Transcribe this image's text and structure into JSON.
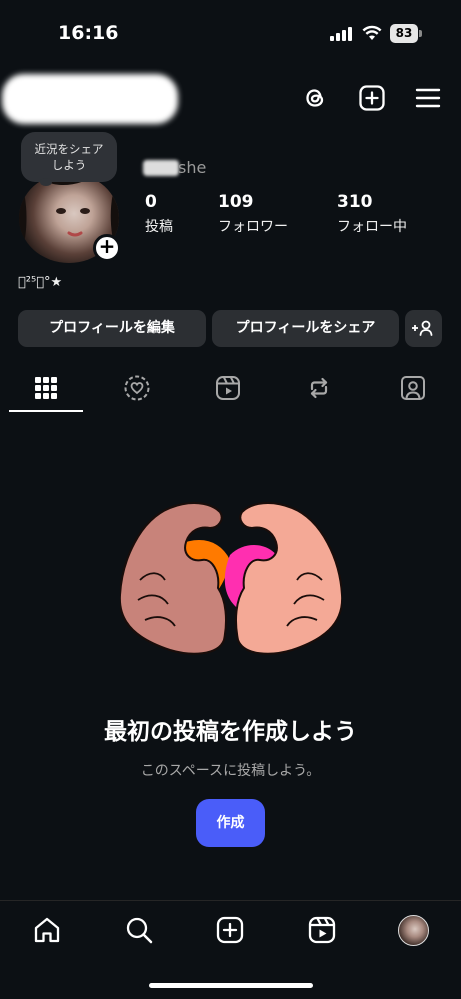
{
  "status_bar": {
    "time": "16:16",
    "battery_level": "83",
    "signal_icon": "cellular-signal-icon",
    "wifi_icon": "wifi-icon"
  },
  "header": {
    "username_redacted": true,
    "icons": [
      "threads-icon",
      "create-plus-icon",
      "hamburger-menu-icon"
    ]
  },
  "profile": {
    "note": [
      "近況をシェア",
      "しよう"
    ],
    "display_name_suffix": "she",
    "bio": "𧢇²⁵･°★",
    "stats": [
      {
        "value": "0",
        "label": "投稿"
      },
      {
        "value": "109",
        "label": "フォロワー"
      },
      {
        "value": "310",
        "label": "フォロー中"
      }
    ]
  },
  "buttons": {
    "edit_profile": "プロフィールを編集",
    "share_profile": "プロフィールをシェア",
    "add_person": "+👤"
  },
  "tabs": [
    "grid-icon",
    "highlights-heart-icon",
    "reels-icon",
    "reposts-icon",
    "tagged-icon"
  ],
  "empty_state": {
    "title": "最初の投稿を作成しよう",
    "subtitle": "このスペースに投稿しよう。",
    "button": "作成"
  },
  "bottom_nav": [
    "home-icon",
    "search-icon",
    "create-icon",
    "reels-icon",
    "profile-avatar"
  ],
  "colors": {
    "background": "#0c1014",
    "button_bg": "#2c2f33",
    "accent_blue": "#4a5df9",
    "text_secondary": "#a8a8a8"
  }
}
